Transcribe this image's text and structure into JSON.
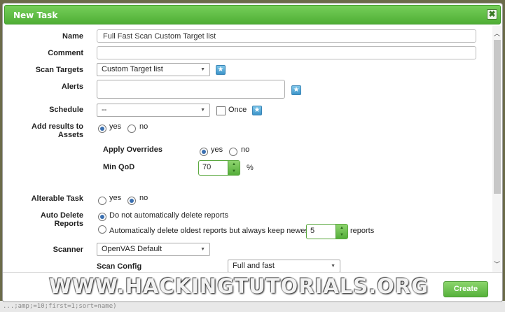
{
  "dialog": {
    "title": "New Task",
    "close_icon": "✖"
  },
  "form": {
    "name_label": "Name",
    "name_value": "Full Fast Scan Custom Target list",
    "comment_label": "Comment",
    "comment_value": "",
    "scan_targets_label": "Scan Targets",
    "scan_targets_value": "Custom Target list",
    "alerts_label": "Alerts",
    "schedule_label": "Schedule",
    "schedule_value": "--",
    "schedule_once_label": "Once",
    "add_results_label_1": "Add results to",
    "add_results_label_2": "Assets",
    "yes": "yes",
    "no": "no",
    "apply_overrides_label": "Apply Overrides",
    "min_qod_label": "Min QoD",
    "min_qod_value": "70",
    "min_qod_unit": "%",
    "alterable_label": "Alterable Task",
    "auto_delete_label_1": "Auto Delete",
    "auto_delete_label_2": "Reports",
    "auto_delete_opt1": "Do not automatically delete reports",
    "auto_delete_opt2": "Automatically delete oldest reports but always keep newest",
    "auto_delete_keep_value": "5",
    "auto_delete_unit": "reports",
    "scanner_label": "Scanner",
    "scanner_value": "OpenVAS Default",
    "scan_config_label": "Scan Config",
    "scan_config_value": "Full and fast"
  },
  "footer": {
    "create_label": "Create"
  },
  "watermark": "WWW.HACKINGTUTORIALS.ORG",
  "background_strip": "...;amp;=10;first=1;sort=name)",
  "colors": {
    "accent_green": "#56b13b",
    "radio_selected": "#3a6fb0",
    "star_blue": "#3e95c9"
  }
}
